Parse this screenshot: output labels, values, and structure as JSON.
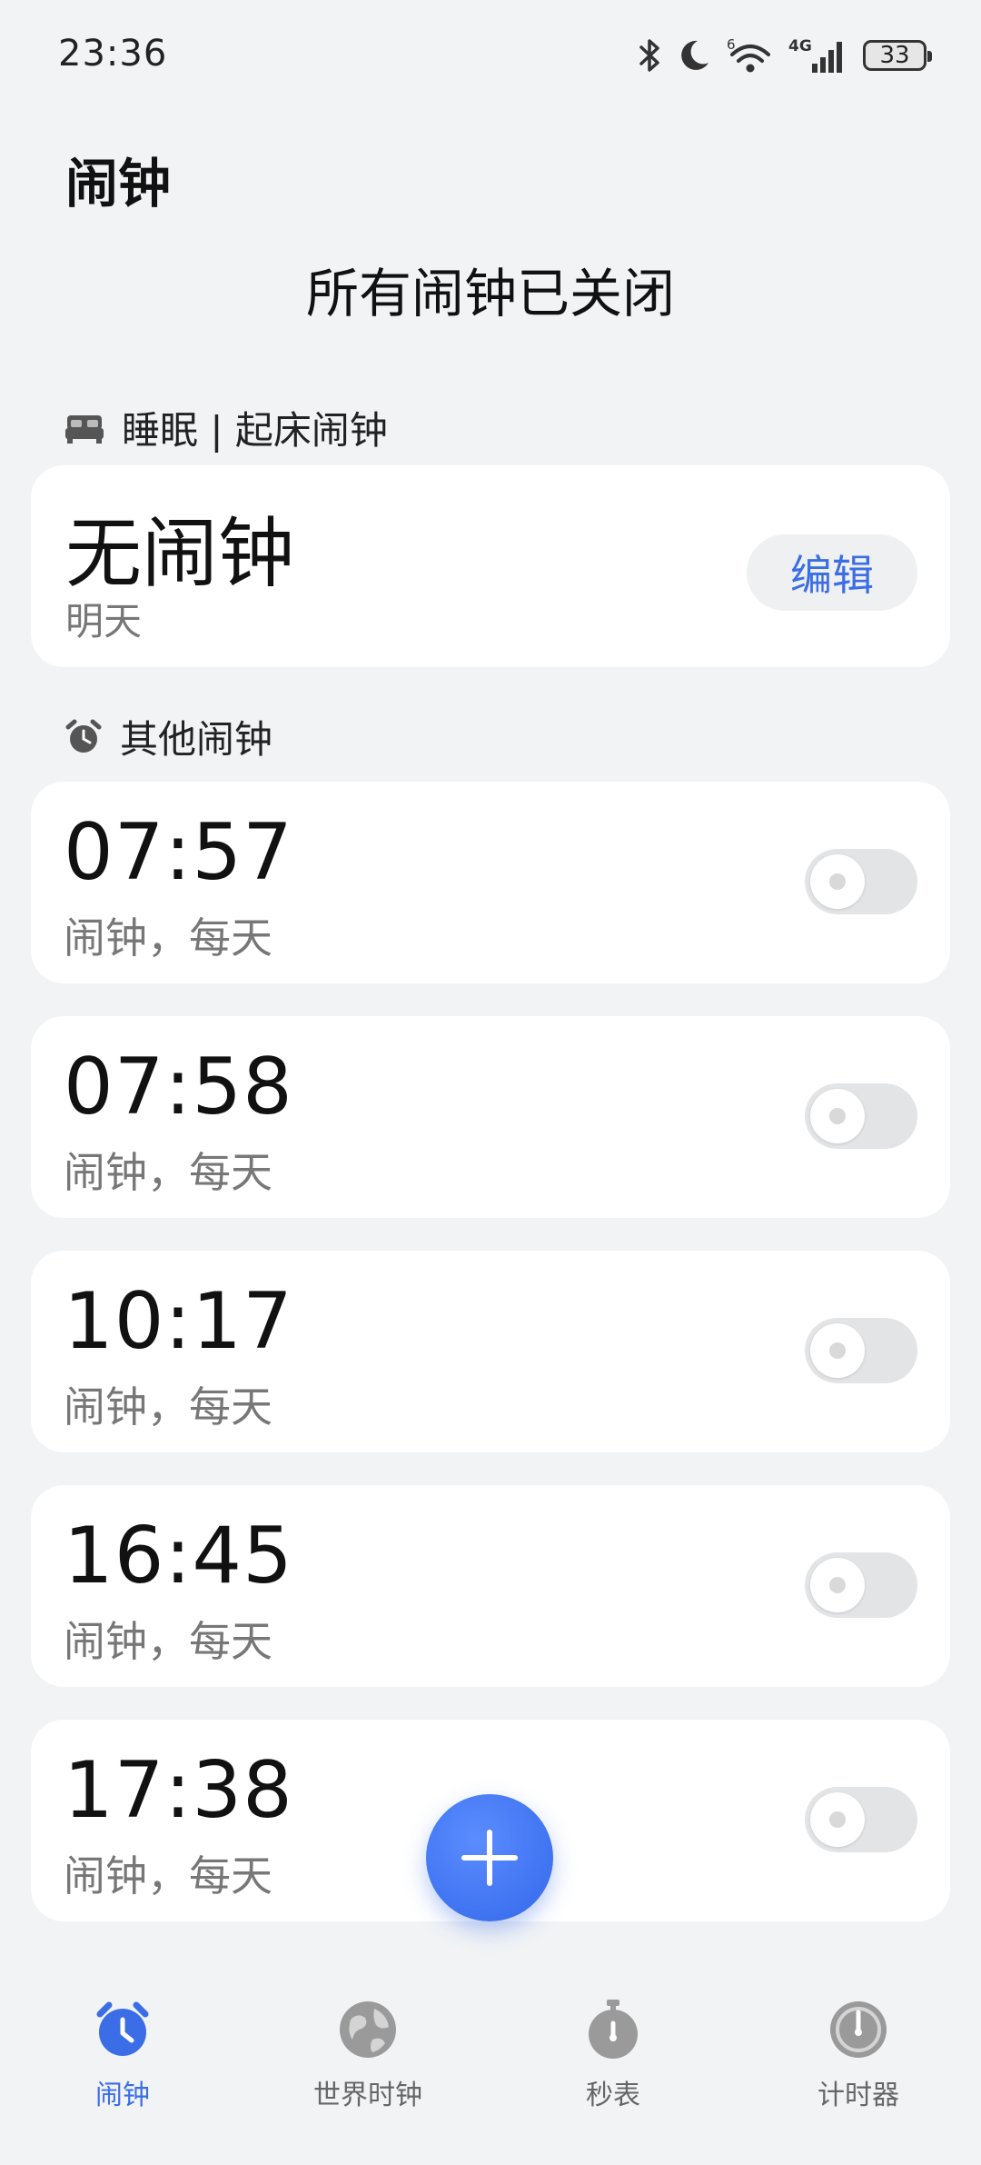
{
  "status_bar": {
    "time": "23:36",
    "battery": "33",
    "network": "4G",
    "sim": "6"
  },
  "header": {
    "title": "闹钟",
    "summary": "所有闹钟已关闭"
  },
  "sleep_section": {
    "label": "睡眠 | 起床闹钟",
    "card_title": "无闹钟",
    "card_subtitle": "明天",
    "edit_label": "编辑"
  },
  "other_section": {
    "label": "其他闹钟"
  },
  "alarms": [
    {
      "time": "07:57",
      "label": "闹钟，每天",
      "enabled": false
    },
    {
      "time": "07:58",
      "label": "闹钟，每天",
      "enabled": false
    },
    {
      "time": "10:17",
      "label": "闹钟，每天",
      "enabled": false
    },
    {
      "time": "16:45",
      "label": "闹钟，每天",
      "enabled": false
    },
    {
      "time": "17:38",
      "label": "闹钟，每天",
      "enabled": false
    }
  ],
  "bottom_nav": {
    "items": [
      {
        "label": "闹钟",
        "icon": "alarm-clock-icon",
        "active": true
      },
      {
        "label": "世界时钟",
        "icon": "globe-icon",
        "active": false
      },
      {
        "label": "秒表",
        "icon": "stopwatch-icon",
        "active": false
      },
      {
        "label": "计时器",
        "icon": "timer-icon",
        "active": false
      }
    ]
  },
  "colors": {
    "accent": "#3b6ee6",
    "background": "#f1f3f5",
    "card": "#ffffff",
    "toggle_off": "#e3e4e6"
  }
}
